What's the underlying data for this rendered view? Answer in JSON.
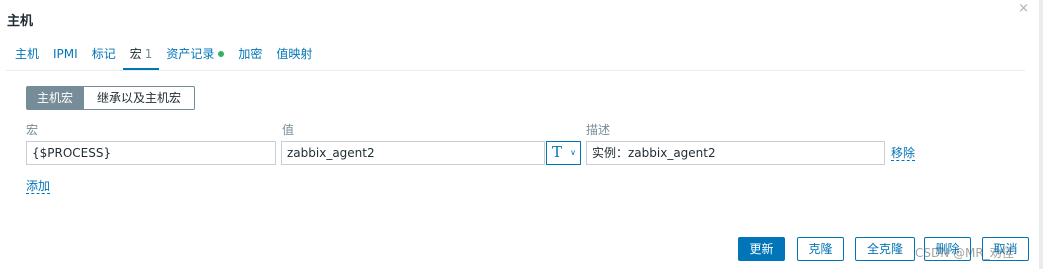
{
  "dialog": {
    "title": "主机",
    "close_icon": "×"
  },
  "tabs": [
    {
      "label": "主机"
    },
    {
      "label": "IPMI"
    },
    {
      "label": "标记"
    },
    {
      "label": "宏",
      "count": "1",
      "active": true
    },
    {
      "label": "资产记录",
      "indicator": "green-dot"
    },
    {
      "label": "加密"
    },
    {
      "label": "值映射"
    }
  ],
  "macro_toggle": {
    "host_macros": "主机宏",
    "inherited_macros": "继承以及主机宏"
  },
  "columns": {
    "macro": "宏",
    "value": "值",
    "description": "描述"
  },
  "macro_rows": [
    {
      "macro": "{$PROCESS}",
      "value": "zabbix_agent2",
      "type_icon": "text-type-icon",
      "type_glyph": "T",
      "description": "实例：zabbix_agent2",
      "remove": "移除"
    }
  ],
  "add_label": "添加",
  "footer": {
    "update": "更新",
    "clone": "克隆",
    "full_clone": "全克隆",
    "delete": "删除",
    "cancel": "取消"
  },
  "watermark": "CSDN @MR_劝佳",
  "colors": {
    "accent": "#0275b8",
    "muted": "#768d99",
    "border": "#c5cfd5",
    "indicator_green": "#34af67"
  }
}
